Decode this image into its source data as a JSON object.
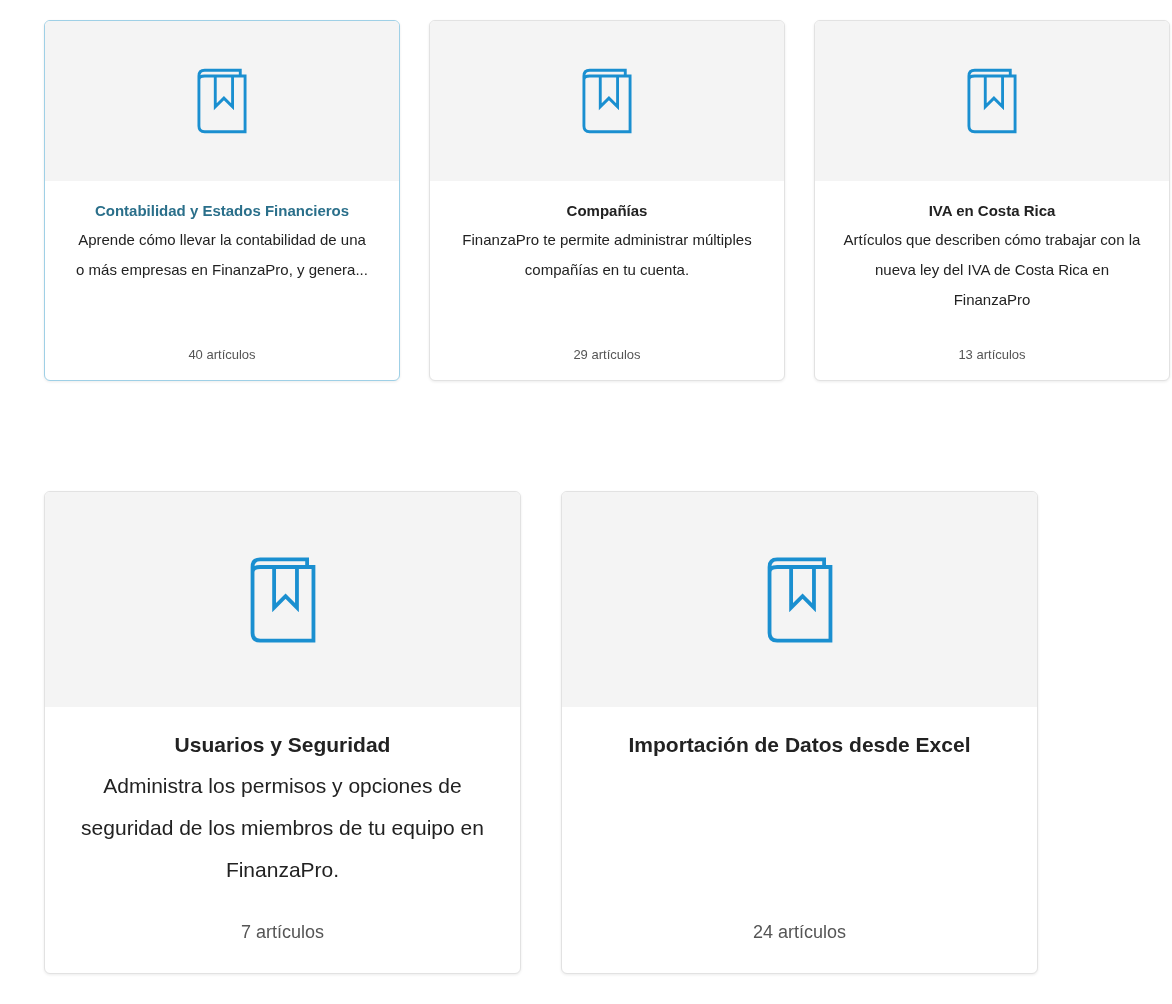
{
  "sections": [
    {
      "kind": "compact",
      "cards": [
        {
          "title": "Contabilidad y Estados Financieros",
          "description": "Aprende cómo llevar la contabilidad de una o más empresas en FinanzaPro, y genera...",
          "count": "40 artículos",
          "highlighted": true
        },
        {
          "title": "Compañías",
          "description": "FinanzaPro te permite administrar múltiples compañías en tu cuenta.",
          "count": "29 artículos",
          "highlighted": false
        },
        {
          "title": "IVA en Costa Rica",
          "description": "Artículos que describen cómo trabajar con la nueva ley del IVA de Costa Rica en FinanzaPro",
          "count": "13 artículos",
          "highlighted": false
        }
      ]
    },
    {
      "kind": "large",
      "cards": [
        {
          "title": "Usuarios y Seguridad",
          "description": "Administra los permisos y opciones de seguridad de los miembros de tu equipo en FinanzaPro.",
          "count": "7 artículos",
          "highlighted": false
        },
        {
          "title": "Importación de Datos desde Excel",
          "count": "24 artículos",
          "highlighted": false
        }
      ]
    }
  ]
}
